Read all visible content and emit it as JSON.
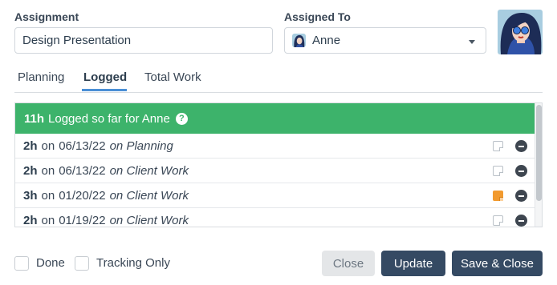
{
  "form": {
    "assignment_label": "Assignment",
    "assignment_value": "Design Presentation",
    "assigned_to_label": "Assigned To",
    "assigned_to_value": "Anne"
  },
  "tabs": [
    {
      "label": "Planning",
      "active": false
    },
    {
      "label": "Logged",
      "active": true
    },
    {
      "label": "Total Work",
      "active": false
    }
  ],
  "summary": {
    "hours": "11h",
    "text": "Logged so far for Anne",
    "help_glyph": "?"
  },
  "entries": [
    {
      "hours": "2h",
      "on": "on",
      "date": "06/13/22",
      "category": "on Planning",
      "has_note": false
    },
    {
      "hours": "2h",
      "on": "on",
      "date": "06/13/22",
      "category": "on Client Work",
      "has_note": false
    },
    {
      "hours": "3h",
      "on": "on",
      "date": "01/20/22",
      "category": "on Client Work",
      "has_note": true
    },
    {
      "hours": "2h",
      "on": "on",
      "date": "01/19/22",
      "category": "on Client Work",
      "has_note": false
    }
  ],
  "options": {
    "done_label": "Done",
    "done_checked": false,
    "tracking_only_label": "Tracking Only",
    "tracking_only_checked": false
  },
  "buttons": {
    "close": "Close",
    "update": "Update",
    "save_close": "Save & Close"
  },
  "colors": {
    "summary_bg": "#3db36b",
    "primary_button": "#354a63",
    "tab_accent": "#4a8fd6",
    "note_accent": "#f29a2e"
  },
  "icons": {
    "avatar": "woman-avatar-icon",
    "dropdown": "chevron-down-icon",
    "help": "question-circle-icon",
    "note": "note-icon",
    "remove": "minus-circle-icon"
  }
}
